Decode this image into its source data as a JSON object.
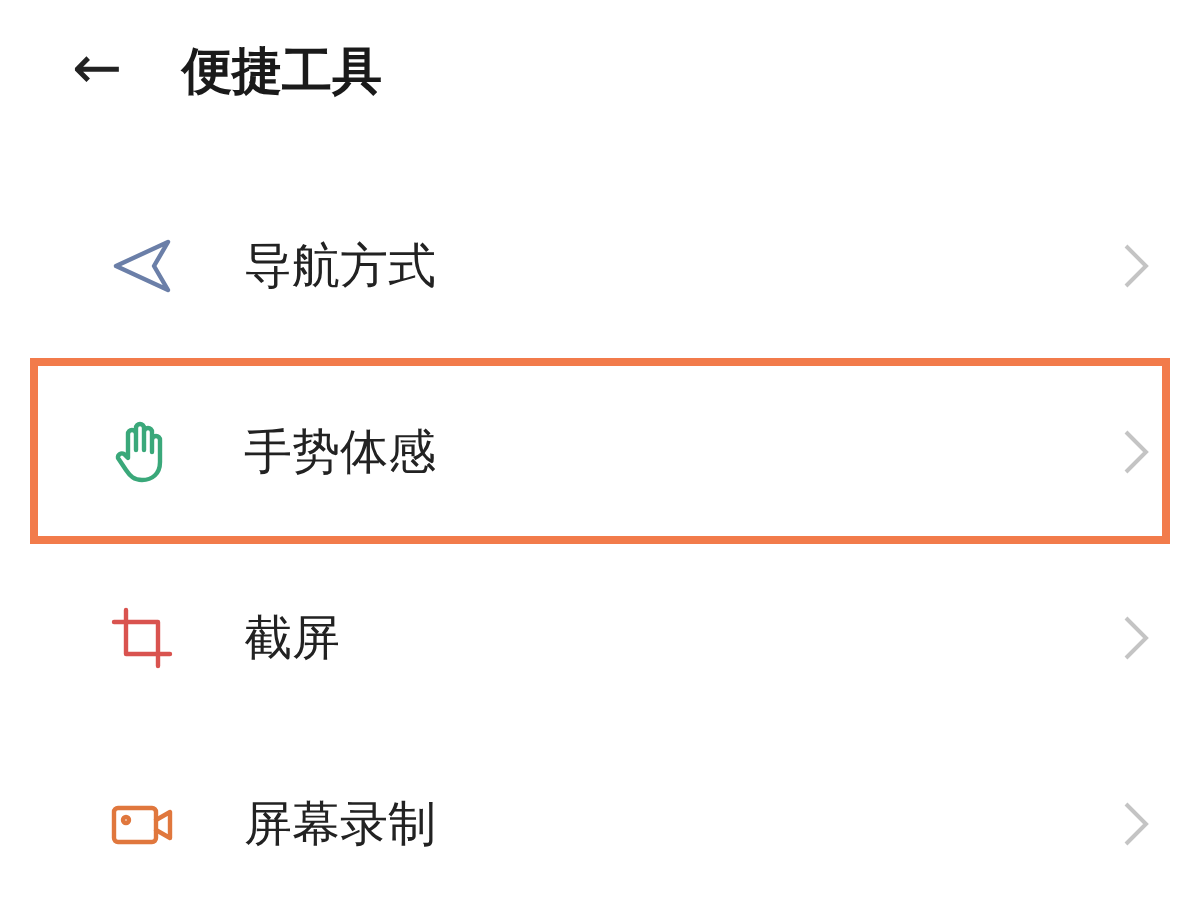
{
  "header": {
    "back": "←",
    "title": "便捷工具"
  },
  "items": [
    {
      "label": "导航方式",
      "color": "#6b7fa8",
      "highlighted": false
    },
    {
      "label": "手势体感",
      "color": "#3aa87a",
      "highlighted": true
    },
    {
      "label": "截屏",
      "color": "#d9534f",
      "highlighted": false
    },
    {
      "label": "屏幕录制",
      "color": "#e0773d",
      "highlighted": false
    }
  ]
}
